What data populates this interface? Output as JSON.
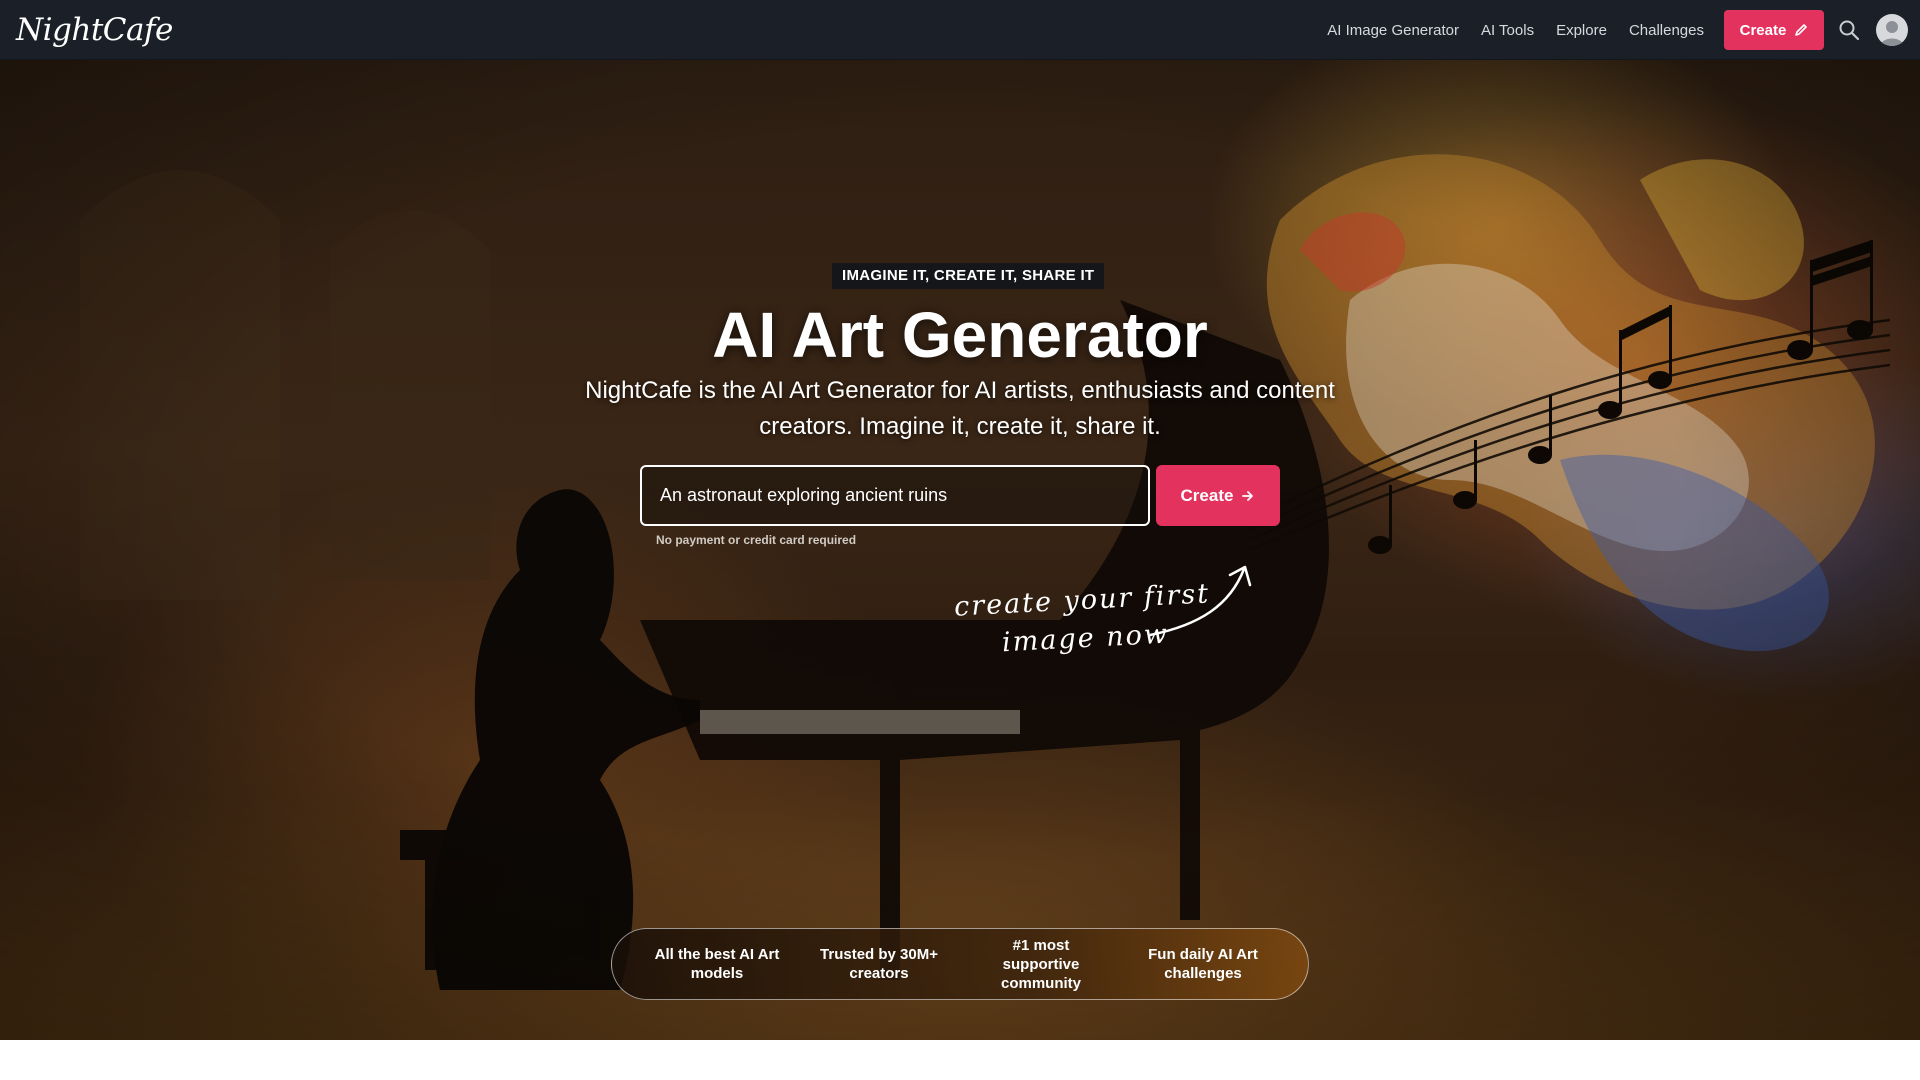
{
  "nav": {
    "logo": "NightCafe",
    "links": [
      "AI Image Generator",
      "AI Tools",
      "Explore",
      "Challenges"
    ],
    "create_label": "Create",
    "icons": {
      "create": "pencil-icon",
      "search": "search-icon",
      "avatar": "user-avatar"
    }
  },
  "hero": {
    "tagline": "IMAGINE IT, CREATE IT, SHARE IT",
    "title": "AI Art Generator",
    "subtitle": "NightCafe is the AI Art Generator for AI artists, enthusiasts and content creators. Imagine it, create it, share it.",
    "prompt_value": "An astronaut exploring ancient ruins",
    "create_label": "Create",
    "no_payment": "No payment or credit card required",
    "handwriting_line1": "create your first",
    "handwriting_line2": "image now",
    "features": [
      "All the best AI Art models",
      "Trusted by 30M+ creators",
      "#1 most supportive community",
      "Fun daily AI Art challenges"
    ]
  },
  "colors": {
    "navbar": "#1b1f27",
    "accent": "#e4325f",
    "text": "#ffffff"
  }
}
